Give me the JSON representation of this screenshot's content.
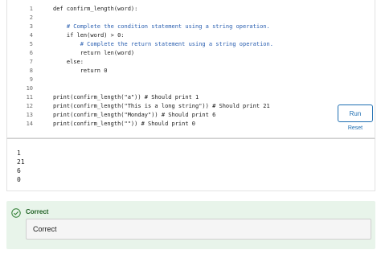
{
  "editor": {
    "line_numbers": [
      "1",
      "2",
      "3",
      "4",
      "5",
      "6",
      "7",
      "8",
      "9",
      "10",
      "11",
      "12",
      "13",
      "14"
    ],
    "lines": [
      "def confirm_length(word):",
      "",
      "    # Complete the condition statement using a string operation.",
      "    if len(word) > 0:",
      "        # Complete the return statement using a string operation.",
      "        return len(word)",
      "    else:",
      "        return 0",
      "",
      "",
      "print(confirm_length(\"a\")) # Should print 1",
      "print(confirm_length(\"This is a long string\")) # Should print 21",
      "print(confirm_length(\"Monday\")) # Should print 6",
      "print(confirm_length(\"\")) # Should print 0"
    ]
  },
  "controls": {
    "run_label": "Run",
    "reset_label": "Reset"
  },
  "output": {
    "lines": [
      "1",
      "21",
      "6",
      "0"
    ]
  },
  "feedback": {
    "title": "Correct",
    "message": "Correct",
    "color": "#1b5e20",
    "background": "#e8f4ea"
  }
}
